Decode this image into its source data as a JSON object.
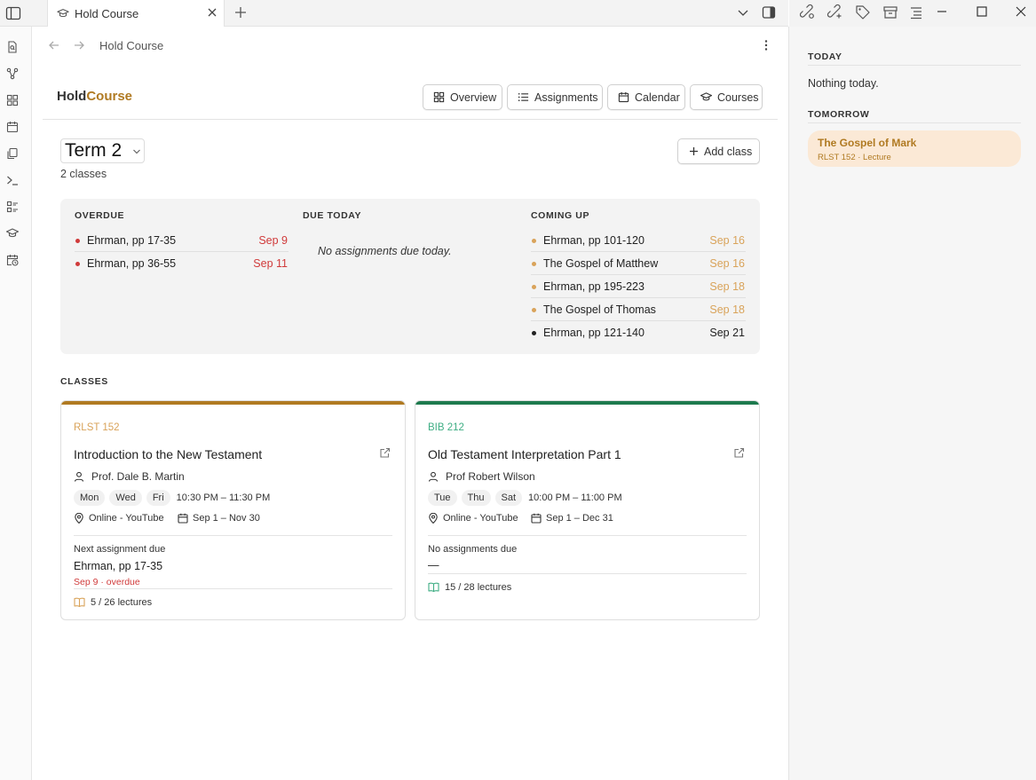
{
  "tab": {
    "title": "Hold Course"
  },
  "nav": {
    "title": "Hold Course"
  },
  "brand": {
    "hold": "Hold",
    "course": "Course"
  },
  "header_buttons": {
    "overview": "Overview",
    "assignments": "Assignments",
    "calendar": "Calendar",
    "courses": "Courses"
  },
  "term": {
    "selected": "Term 2",
    "count": "2 classes",
    "add_class": "Add class"
  },
  "summary": {
    "overdue": {
      "heading": "OVERDUE",
      "items": [
        {
          "name": "Ehrman, pp 17-35",
          "date": "Sep 9"
        },
        {
          "name": "Ehrman, pp 36-55",
          "date": "Sep 11"
        }
      ]
    },
    "due_today": {
      "heading": "DUE TODAY",
      "empty": "No assignments due today."
    },
    "coming_up": {
      "heading": "COMING UP",
      "items": [
        {
          "name": "Ehrman, pp 101-120",
          "date": "Sep 16"
        },
        {
          "name": "The Gospel of Matthew",
          "date": "Sep 16"
        },
        {
          "name": "Ehrman, pp 195-223",
          "date": "Sep 18"
        },
        {
          "name": "The Gospel of Thomas",
          "date": "Sep 18"
        },
        {
          "name": "Ehrman, pp 121-140",
          "date": "Sep 21"
        }
      ]
    }
  },
  "classes": {
    "heading": "CLASSES",
    "cards": [
      {
        "code": "RLST 152",
        "title": "Introduction to the New Testament",
        "professor": "Prof. Dale B. Martin",
        "days": [
          "Mon",
          "Wed",
          "Fri"
        ],
        "time": "10:30 PM – 11:30 PM",
        "location": "Online - YouTube",
        "dates": "Sep 1 – Nov 30",
        "next_label": "Next assignment due",
        "next_name": "Ehrman, pp 17-35",
        "next_date": "Sep 9 · overdue",
        "lectures": "5 / 26 lectures",
        "accent": "#b07a22"
      },
      {
        "code": "BIB 212",
        "title": "Old Testament Interpretation Part 1",
        "professor": "Prof Robert Wilson",
        "days": [
          "Tue",
          "Thu",
          "Sat"
        ],
        "time": "10:00 PM – 11:00 PM",
        "location": "Online - YouTube",
        "dates": "Sep 1 – Dec 31",
        "next_label": "No assignments due",
        "next_name": "—",
        "lectures": "15 / 28 lectures",
        "accent": "#1e7a4e"
      }
    ]
  },
  "right_panel": {
    "today_heading": "TODAY",
    "today_empty": "Nothing today.",
    "tomorrow_heading": "TOMORROW",
    "event_title": "The Gospel of Mark",
    "event_sub": "RLST 152 · Lecture"
  },
  "colors": {
    "accent": "#b07a22",
    "overdue": "#d03a3a",
    "upcoming": "#d9a35a",
    "green": "#1e7a4e",
    "event_bg": "#fbe9d6"
  },
  "icons": [
    "sidebar-toggle-icon",
    "graduation-cap-icon",
    "close-icon",
    "plus-icon",
    "chevron-down-icon",
    "right-sidebar-icon",
    "arrow-left-icon",
    "arrow-right-icon",
    "more-vertical-icon",
    "grid-icon",
    "list-icon",
    "calendar-icon",
    "external-link-icon",
    "user-icon",
    "map-pin-icon",
    "book-open-icon"
  ]
}
